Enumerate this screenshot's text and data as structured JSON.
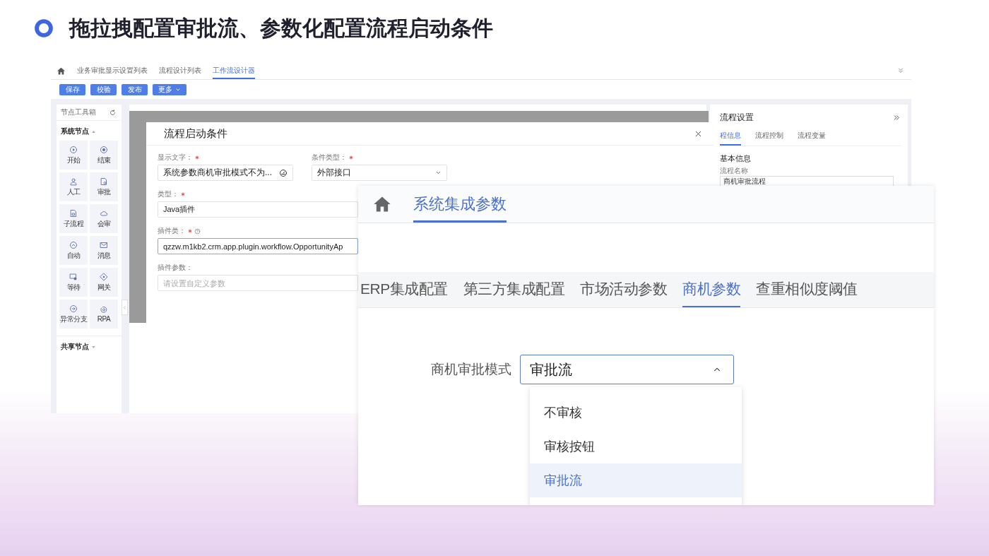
{
  "slide": {
    "title": "拖拉拽配置审批流、参数化配置流程启动条件"
  },
  "designer": {
    "nav_tabs": [
      {
        "label": "业务审批显示设置列表",
        "selected": false
      },
      {
        "label": "流程设计列表",
        "selected": false
      },
      {
        "label": "工作流设计器",
        "selected": true
      }
    ],
    "toolbar": [
      {
        "label": "保存",
        "kind": "button"
      },
      {
        "label": "校验",
        "kind": "button"
      },
      {
        "label": "发布",
        "kind": "button"
      },
      {
        "label": "更多",
        "kind": "menu"
      }
    ],
    "toolbox": {
      "title": "节点工具箱",
      "sections": [
        {
          "label": "系统节点",
          "expanded": true,
          "nodes": [
            {
              "label": "开始",
              "kind": "start"
            },
            {
              "label": "结束",
              "kind": "end"
            },
            {
              "label": "人工",
              "kind": "manual"
            },
            {
              "label": "审批",
              "kind": "approve"
            },
            {
              "label": "子流程",
              "kind": "subflow"
            },
            {
              "label": "会审",
              "kind": "joint"
            },
            {
              "label": "自动",
              "kind": "auto"
            },
            {
              "label": "消息",
              "kind": "message"
            },
            {
              "label": "等待",
              "kind": "wait"
            },
            {
              "label": "网关",
              "kind": "gateway"
            },
            {
              "label": "异常分支",
              "kind": "exception"
            },
            {
              "label": "RPA",
              "kind": "rpa"
            }
          ]
        },
        {
          "label": "共享节点",
          "expanded": false
        }
      ]
    },
    "dialog": {
      "title": "流程启动条件",
      "rows": [
        {
          "fields": [
            {
              "label": "显示文字：",
              "required": true,
              "help": false,
              "kind": "picker",
              "value": "系统参数商机审批模式不为...",
              "focused": false
            },
            {
              "label": "条件类型：",
              "required": true,
              "help": false,
              "kind": "select",
              "value": "外部接口",
              "focused": false
            }
          ]
        },
        {
          "fields": [
            {
              "label": "类型：",
              "required": true,
              "help": false,
              "kind": "text",
              "value": "Java插件",
              "focused": false
            }
          ]
        },
        {
          "fields": [
            {
              "label": "插件类：",
              "required": true,
              "help": true,
              "kind": "text",
              "value": "qzzw.m1kb2.crm.app.plugin.workflow.OpportunityAp",
              "focused": true
            }
          ]
        },
        {
          "fields": [
            {
              "label": "插件参数：",
              "required": false,
              "help": false,
              "kind": "text",
              "placeholder": "请设置自定义参数",
              "focused": false
            }
          ]
        }
      ]
    },
    "settings": {
      "title": "流程设置",
      "tabs": [
        {
          "label": "程信息",
          "selected": true
        },
        {
          "label": "流程控制",
          "selected": false
        },
        {
          "label": "流程变量",
          "selected": false
        }
      ],
      "section": "基本信息",
      "fields": [
        {
          "label": "流程名称",
          "value": "商机审批流程"
        }
      ]
    }
  },
  "params": {
    "nav_tabs": [
      {
        "label": "系统集成参数",
        "selected": true
      }
    ],
    "tabs": [
      {
        "label": "ERP集成配置",
        "selected": false
      },
      {
        "label": "第三方集成配置",
        "selected": false
      },
      {
        "label": "市场活动参数",
        "selected": false
      },
      {
        "label": "商机参数",
        "selected": true
      },
      {
        "label": "查重相似度阈值",
        "selected": false
      }
    ],
    "form": {
      "label": "商机审批模式",
      "value": "审批流",
      "expanded": true,
      "options": [
        {
          "label": "不审核",
          "selected": false
        },
        {
          "label": "审核按钮",
          "selected": false
        },
        {
          "label": "审批流",
          "selected": true
        }
      ]
    }
  }
}
